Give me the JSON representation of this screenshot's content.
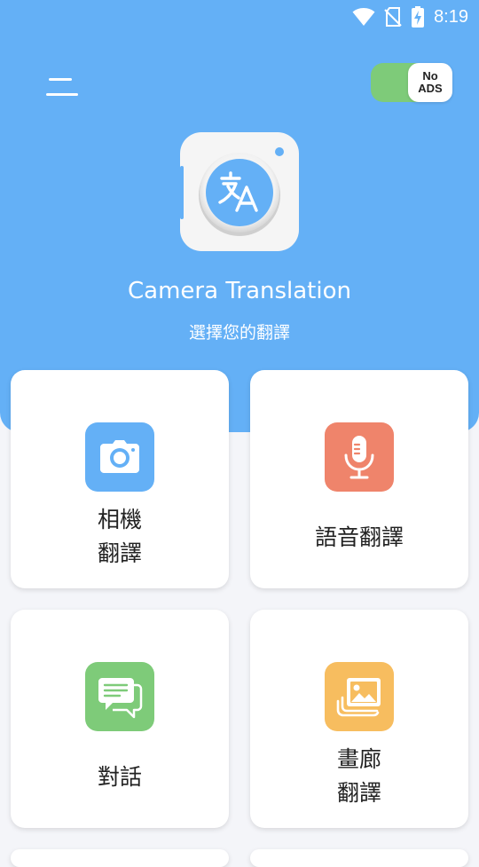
{
  "status_bar": {
    "time": "8:19"
  },
  "header": {
    "no_ads_line1": "No",
    "no_ads_line2": "ADS",
    "app_title": "Camera Translation",
    "subtitle": "選擇您的翻譯"
  },
  "features": [
    {
      "line1": "相機",
      "line2": "翻譯",
      "icon": "camera-icon",
      "color": "#64b0f6"
    },
    {
      "line1": "語音翻譯",
      "line2": "",
      "icon": "microphone-icon",
      "color": "#ef846b"
    },
    {
      "line1": "對話",
      "line2": "",
      "icon": "chat-icon",
      "color": "#7ecb79"
    },
    {
      "line1": "畫廊",
      "line2": "翻譯",
      "icon": "gallery-icon",
      "color": "#f7bd5f"
    }
  ],
  "colors": {
    "primary": "#64b0f6",
    "toggle": "#7ecb79",
    "background": "#f4f5f9"
  }
}
